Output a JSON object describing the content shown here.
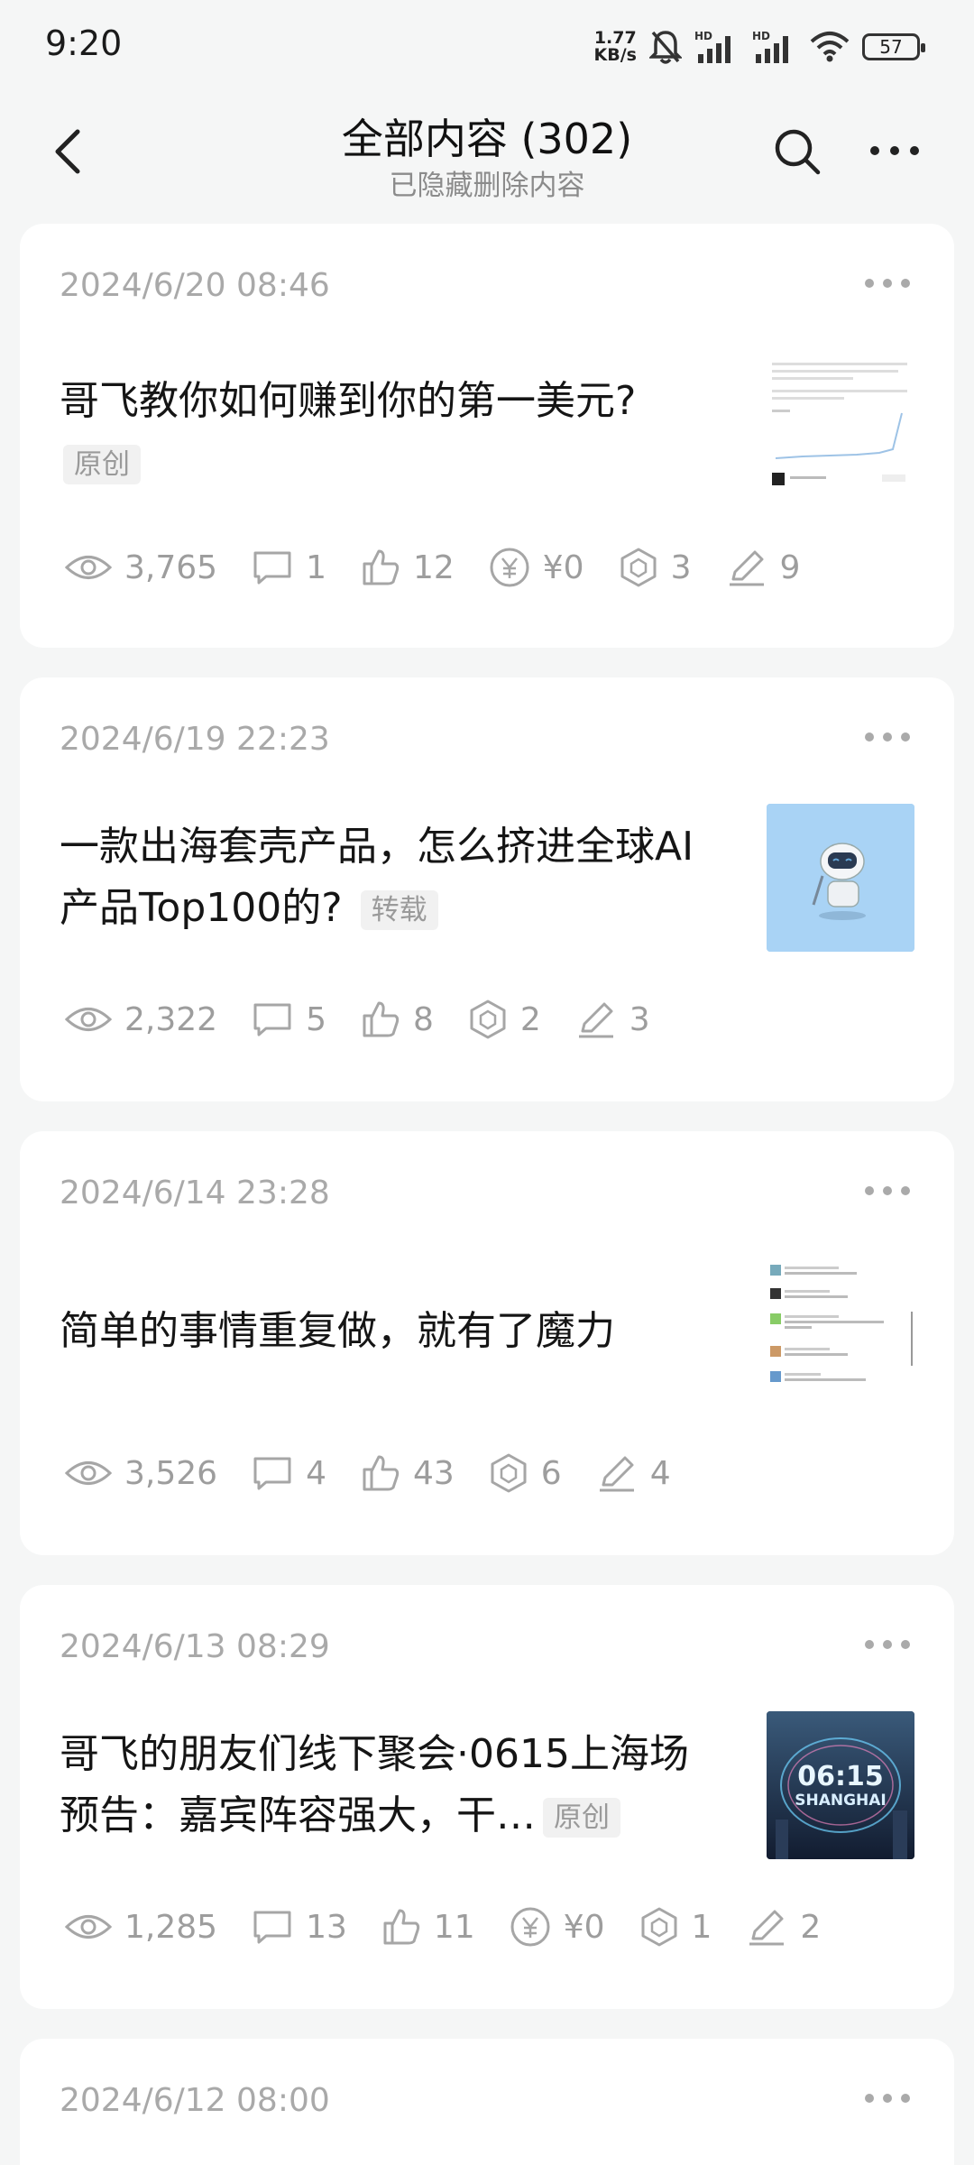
{
  "status_bar": {
    "time": "9:20",
    "net_speed_value": "1.77",
    "net_speed_unit": "KB/s",
    "network_label": "HD",
    "battery": "57"
  },
  "header": {
    "title": "全部内容 (302)",
    "subtitle": "已隐藏删除内容"
  },
  "cards": [
    {
      "date": "2024/6/20 08:46",
      "title": "哥飞教你如何赚到你的第一美元?",
      "tag": "原创",
      "thumb": "screenshot-thumbnail",
      "stats": {
        "views": "3,765",
        "comments": "1",
        "likes": "12",
        "earnings": "¥0",
        "shares": "3",
        "edits": "9"
      }
    },
    {
      "date": "2024/6/19 22:23",
      "title": "一款出海套壳产品，怎么挤进全球AI产品Top100的?",
      "tag": "转载",
      "thumb": "robot-thumbnail",
      "stats": {
        "views": "2,322",
        "comments": "5",
        "likes": "8",
        "shares": "2",
        "edits": "3"
      }
    },
    {
      "date": "2024/6/14 23:28",
      "title": "简单的事情重复做，就有了魔力",
      "tag": "",
      "thumb": "chat-thumbnail",
      "stats": {
        "views": "3,526",
        "comments": "4",
        "likes": "43",
        "shares": "6",
        "edits": "4"
      }
    },
    {
      "date": "2024/6/13 08:29",
      "title": "哥飞的朋友们线下聚会·0615上海场预告：嘉宾阵容强大，干…",
      "tag": "原创",
      "thumb": "shanghai-thumbnail",
      "thumb_text": "06:15",
      "thumb_text2": "SHANGHAI",
      "stats": {
        "views": "1,285",
        "comments": "13",
        "likes": "11",
        "earnings": "¥0",
        "shares": "1",
        "edits": "2"
      }
    },
    {
      "date": "2024/6/12 08:00"
    }
  ],
  "colors": {
    "background": "#f5f6f6",
    "card": "#ffffff",
    "muted_text": "#a9a9a9",
    "tag_bg": "#f1f1f1",
    "robot_bg": "#a9d3f5"
  }
}
